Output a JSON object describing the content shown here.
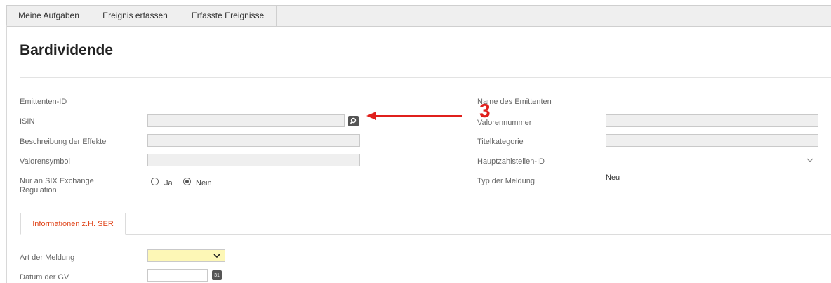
{
  "nav": {
    "tabs": [
      "Meine Aufgaben",
      "Ereignis erfassen",
      "Erfasste Ereignisse"
    ]
  },
  "page": {
    "title": "Bardividende"
  },
  "form_left": {
    "emittenten_id": "Emittenten-ID",
    "isin": "ISIN",
    "beschreibung": "Beschreibung der Effekte",
    "valorensymbol": "Valorensymbol",
    "six_label": "Nur an SIX Exchange Regulation",
    "radio_ja": "Ja",
    "radio_nein": "Nein"
  },
  "form_right": {
    "name_emittent": "Name des Emittenten",
    "valorennummer": "Valorennummer",
    "titelkategorie": "Titelkategorie",
    "hauptzahlstellen": "Hauptzahlstellen-ID",
    "typ_meldung": "Typ der Meldung",
    "typ_value": "Neu"
  },
  "subtab": {
    "label": "Informationen z.H. SER"
  },
  "form_ser": {
    "art_meldung": "Art der Meldung",
    "datum_gv": "Datum der GV",
    "calendar_text": "31"
  },
  "annotation": {
    "number": "3"
  },
  "icons": {
    "search": "search-icon",
    "calendar": "calendar-icon",
    "chevron": "chevron-down-icon",
    "arrow": "arrow-left-icon"
  },
  "colors": {
    "accent": "#e0461c",
    "annotation": "#e0201c",
    "required": "#fdf7b6"
  }
}
